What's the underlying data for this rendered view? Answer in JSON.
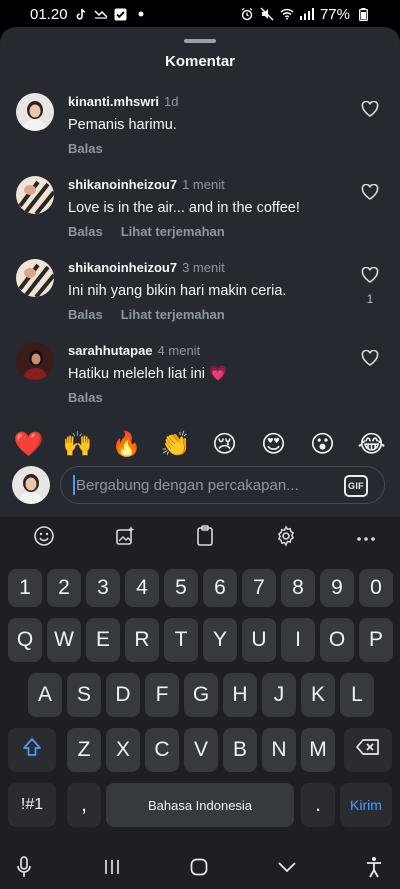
{
  "status_bar": {
    "time": "01.20",
    "battery": "77%"
  },
  "sheet": {
    "title": "Komentar"
  },
  "comments": [
    {
      "username": "kinanti.mhswri",
      "time": "1d",
      "text": "Pemanis harimu.",
      "reply_label": "Balas",
      "translate_label": "",
      "like_count": ""
    },
    {
      "username": "shikanoinheizou7",
      "time": "1 menit",
      "text": "Love is in the air... and in the coffee!",
      "reply_label": "Balas",
      "translate_label": "Lihat terjemahan",
      "like_count": ""
    },
    {
      "username": "shikanoinheizou7",
      "time": "3 menit",
      "text": "Ini nih yang bikin hari makin ceria.",
      "reply_label": "Balas",
      "translate_label": "Lihat terjemahan",
      "like_count": "1"
    },
    {
      "username": "sarahhutapae",
      "time": "4 menit",
      "text": "Hatiku meleleh liat ini 💗",
      "reply_label": "Balas",
      "translate_label": "",
      "like_count": ""
    }
  ],
  "emoji_bar": [
    "❤️",
    "🙌",
    "🔥",
    "👏",
    "😢",
    "😍",
    "😮",
    "😂"
  ],
  "compose": {
    "placeholder": "Bergabung dengan percakapan...",
    "gif_label": "GIF"
  },
  "keyboard": {
    "number_row": [
      "1",
      "2",
      "3",
      "4",
      "5",
      "6",
      "7",
      "8",
      "9",
      "0"
    ],
    "row1": [
      "Q",
      "W",
      "E",
      "R",
      "T",
      "Y",
      "U",
      "I",
      "O",
      "P"
    ],
    "row2": [
      "A",
      "S",
      "D",
      "F",
      "G",
      "H",
      "J",
      "K",
      "L"
    ],
    "row3": [
      "Z",
      "X",
      "C",
      "V",
      "B",
      "N",
      "M"
    ],
    "symbols_label": "!#1",
    "comma_label": ",",
    "space_label": "Bahasa Indonesia",
    "period_label": ".",
    "send_label": "Kirim"
  }
}
